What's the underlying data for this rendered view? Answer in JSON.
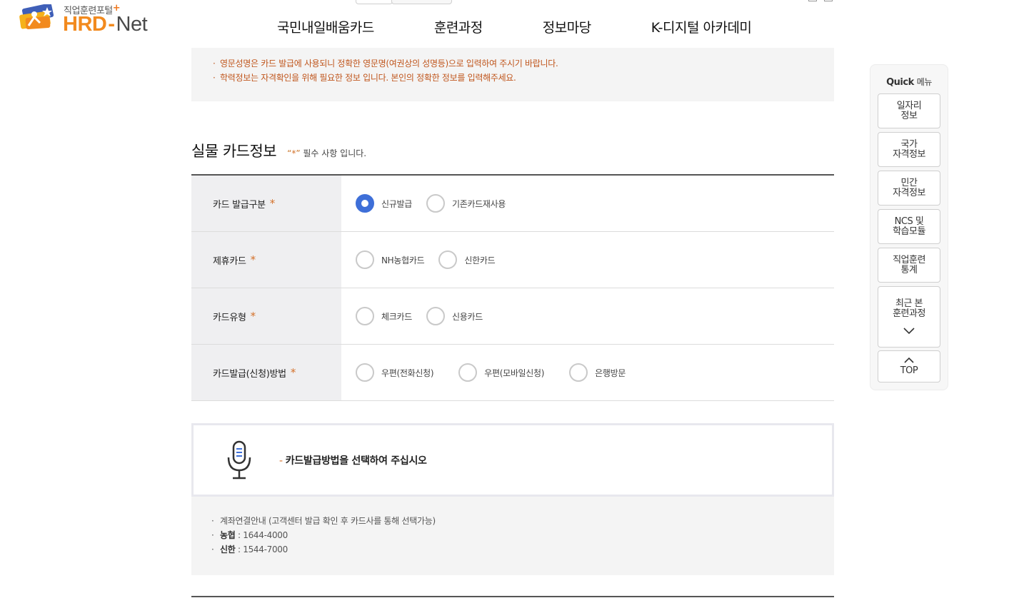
{
  "header": {
    "logo_sub": "직업훈련포털",
    "logo_plus": "+",
    "logo_hrd": "HRD",
    "logo_dash": "-",
    "logo_net": "Net",
    "nav": [
      "국민내일배움카드",
      "훈련과정",
      "정보마당",
      "K-디지털 아카데미"
    ]
  },
  "notice_top": [
    "영문성명은 카드 발급에 사용되니 정확한 영문명(여권상의 성명등)으로 입력하여 주시기 바랍니다.",
    "학력정보는 자격확인을 위해 필요한 정보 입니다. 본인의 정확한 정보를 입력해주세요."
  ],
  "section": {
    "title": "실물 카드정보",
    "req_open": "“",
    "req_star": "*",
    "req_close": "”",
    "req_text": " 필수 사항 입니다."
  },
  "form": {
    "rows": [
      {
        "label": "카드 발급구분",
        "star": "*",
        "options": [
          "신규발급",
          "기존카드재사용"
        ],
        "selected": "신규발급"
      },
      {
        "label": "제휴카드",
        "star": "*",
        "options": [
          "NH농협카드",
          "신한카드"
        ],
        "selected": ""
      },
      {
        "label": "카드유형",
        "star": "*",
        "options": [
          "체크카드",
          "신용카드"
        ],
        "selected": ""
      },
      {
        "label": "카드발급(신청)방법",
        "star": "*",
        "options": [
          "우편(전화신청)",
          "우편(모바일신청)",
          "은행방문"
        ],
        "selected": ""
      }
    ]
  },
  "guide": {
    "icon": "microphone-icon",
    "dash": "-",
    "message": "카드발급방법을 선택하여 주십시오"
  },
  "notice_bottom": {
    "line1": "계좌연결안내 (고객센터 발급 확인 후 카드사를 통해 선택가능)",
    "nh_label": "농협",
    "nh_value": " : 1644-4000",
    "sh_label": "신한",
    "sh_value": " : 1544-7000"
  },
  "quick": {
    "title_en": "Quick",
    "title_ko": "메뉴",
    "items": [
      {
        "line1": "일자리",
        "line2": "정보"
      },
      {
        "line1": "국가",
        "line2": "자격정보"
      },
      {
        "line1": "민간",
        "line2": "자격정보"
      },
      {
        "line1": "NCS 및",
        "line2": "학습모듈"
      },
      {
        "line1": "직업훈련",
        "line2": "통계"
      },
      {
        "line1": "최근 본",
        "line2": "훈련과정"
      }
    ],
    "top_label": "TOP"
  },
  "colors": {
    "accent_blue": "#3e6fd8",
    "required_orange": "#d4712a",
    "notice_text": "#c0561d",
    "brand_orange": "#f28a1e"
  }
}
